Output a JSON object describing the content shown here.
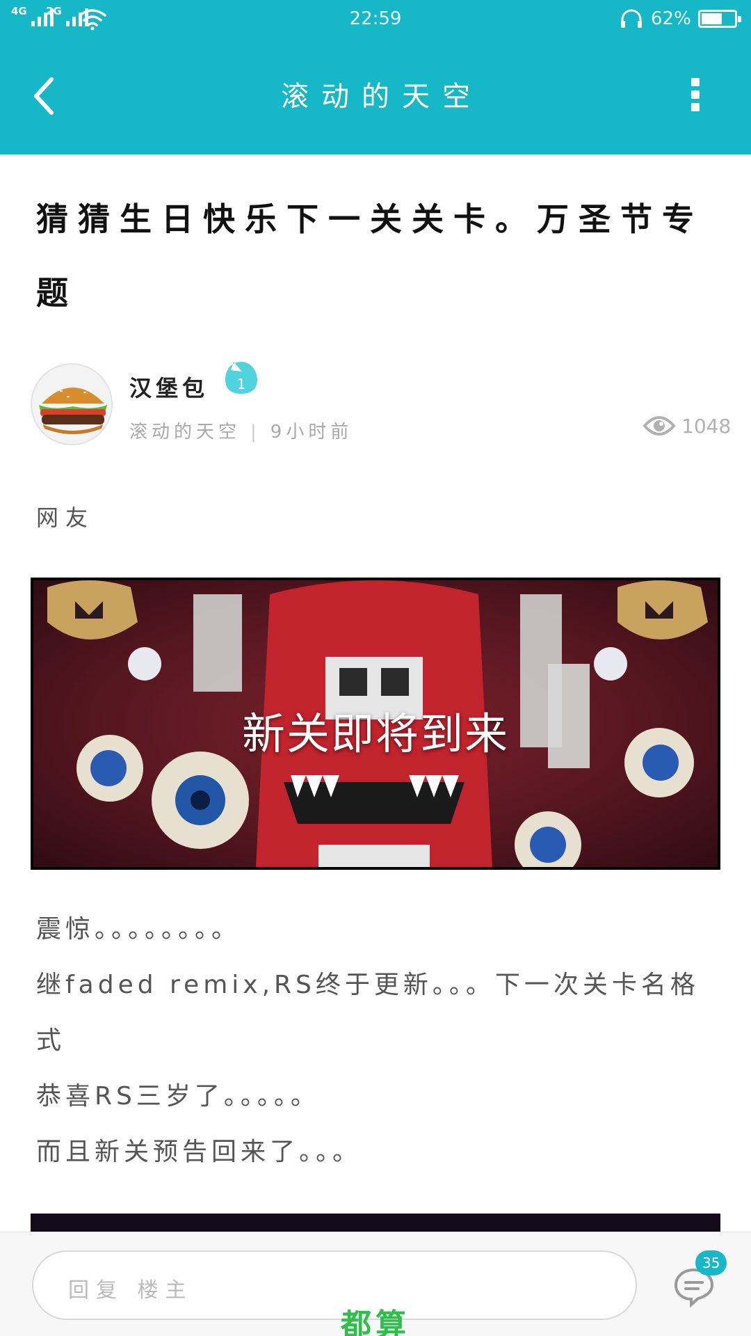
{
  "status_bar": {
    "network_1": "4G",
    "network_2": "2G",
    "time": "22:59",
    "battery_percent": "62%",
    "battery_level": 0.62
  },
  "header": {
    "title": "滚动的天空",
    "back_icon": "chevron-left-icon",
    "menu_icon": "more-vertical-icon"
  },
  "post": {
    "title": "猜猜生日快乐下一关关卡。万圣节专题",
    "author": "汉堡包",
    "author_level": "1",
    "forum": "滚动的天空",
    "time_ago": "9小时前",
    "views": "1048",
    "tag": "网友",
    "banner_caption": "新关即将到来",
    "body": [
      "震惊。。。。。。。。",
      "继faded remix,RS终于更新。。。下一次关卡名格式",
      "恭喜RS三岁了。。。。。",
      "而且新关预告回来了。。。"
    ]
  },
  "footer": {
    "reply_placeholder": "回复 楼主",
    "comment_count": "35",
    "watermark": "都算"
  },
  "colors": {
    "brand": "#16b8c8",
    "watermark": "#2dbf4a"
  }
}
